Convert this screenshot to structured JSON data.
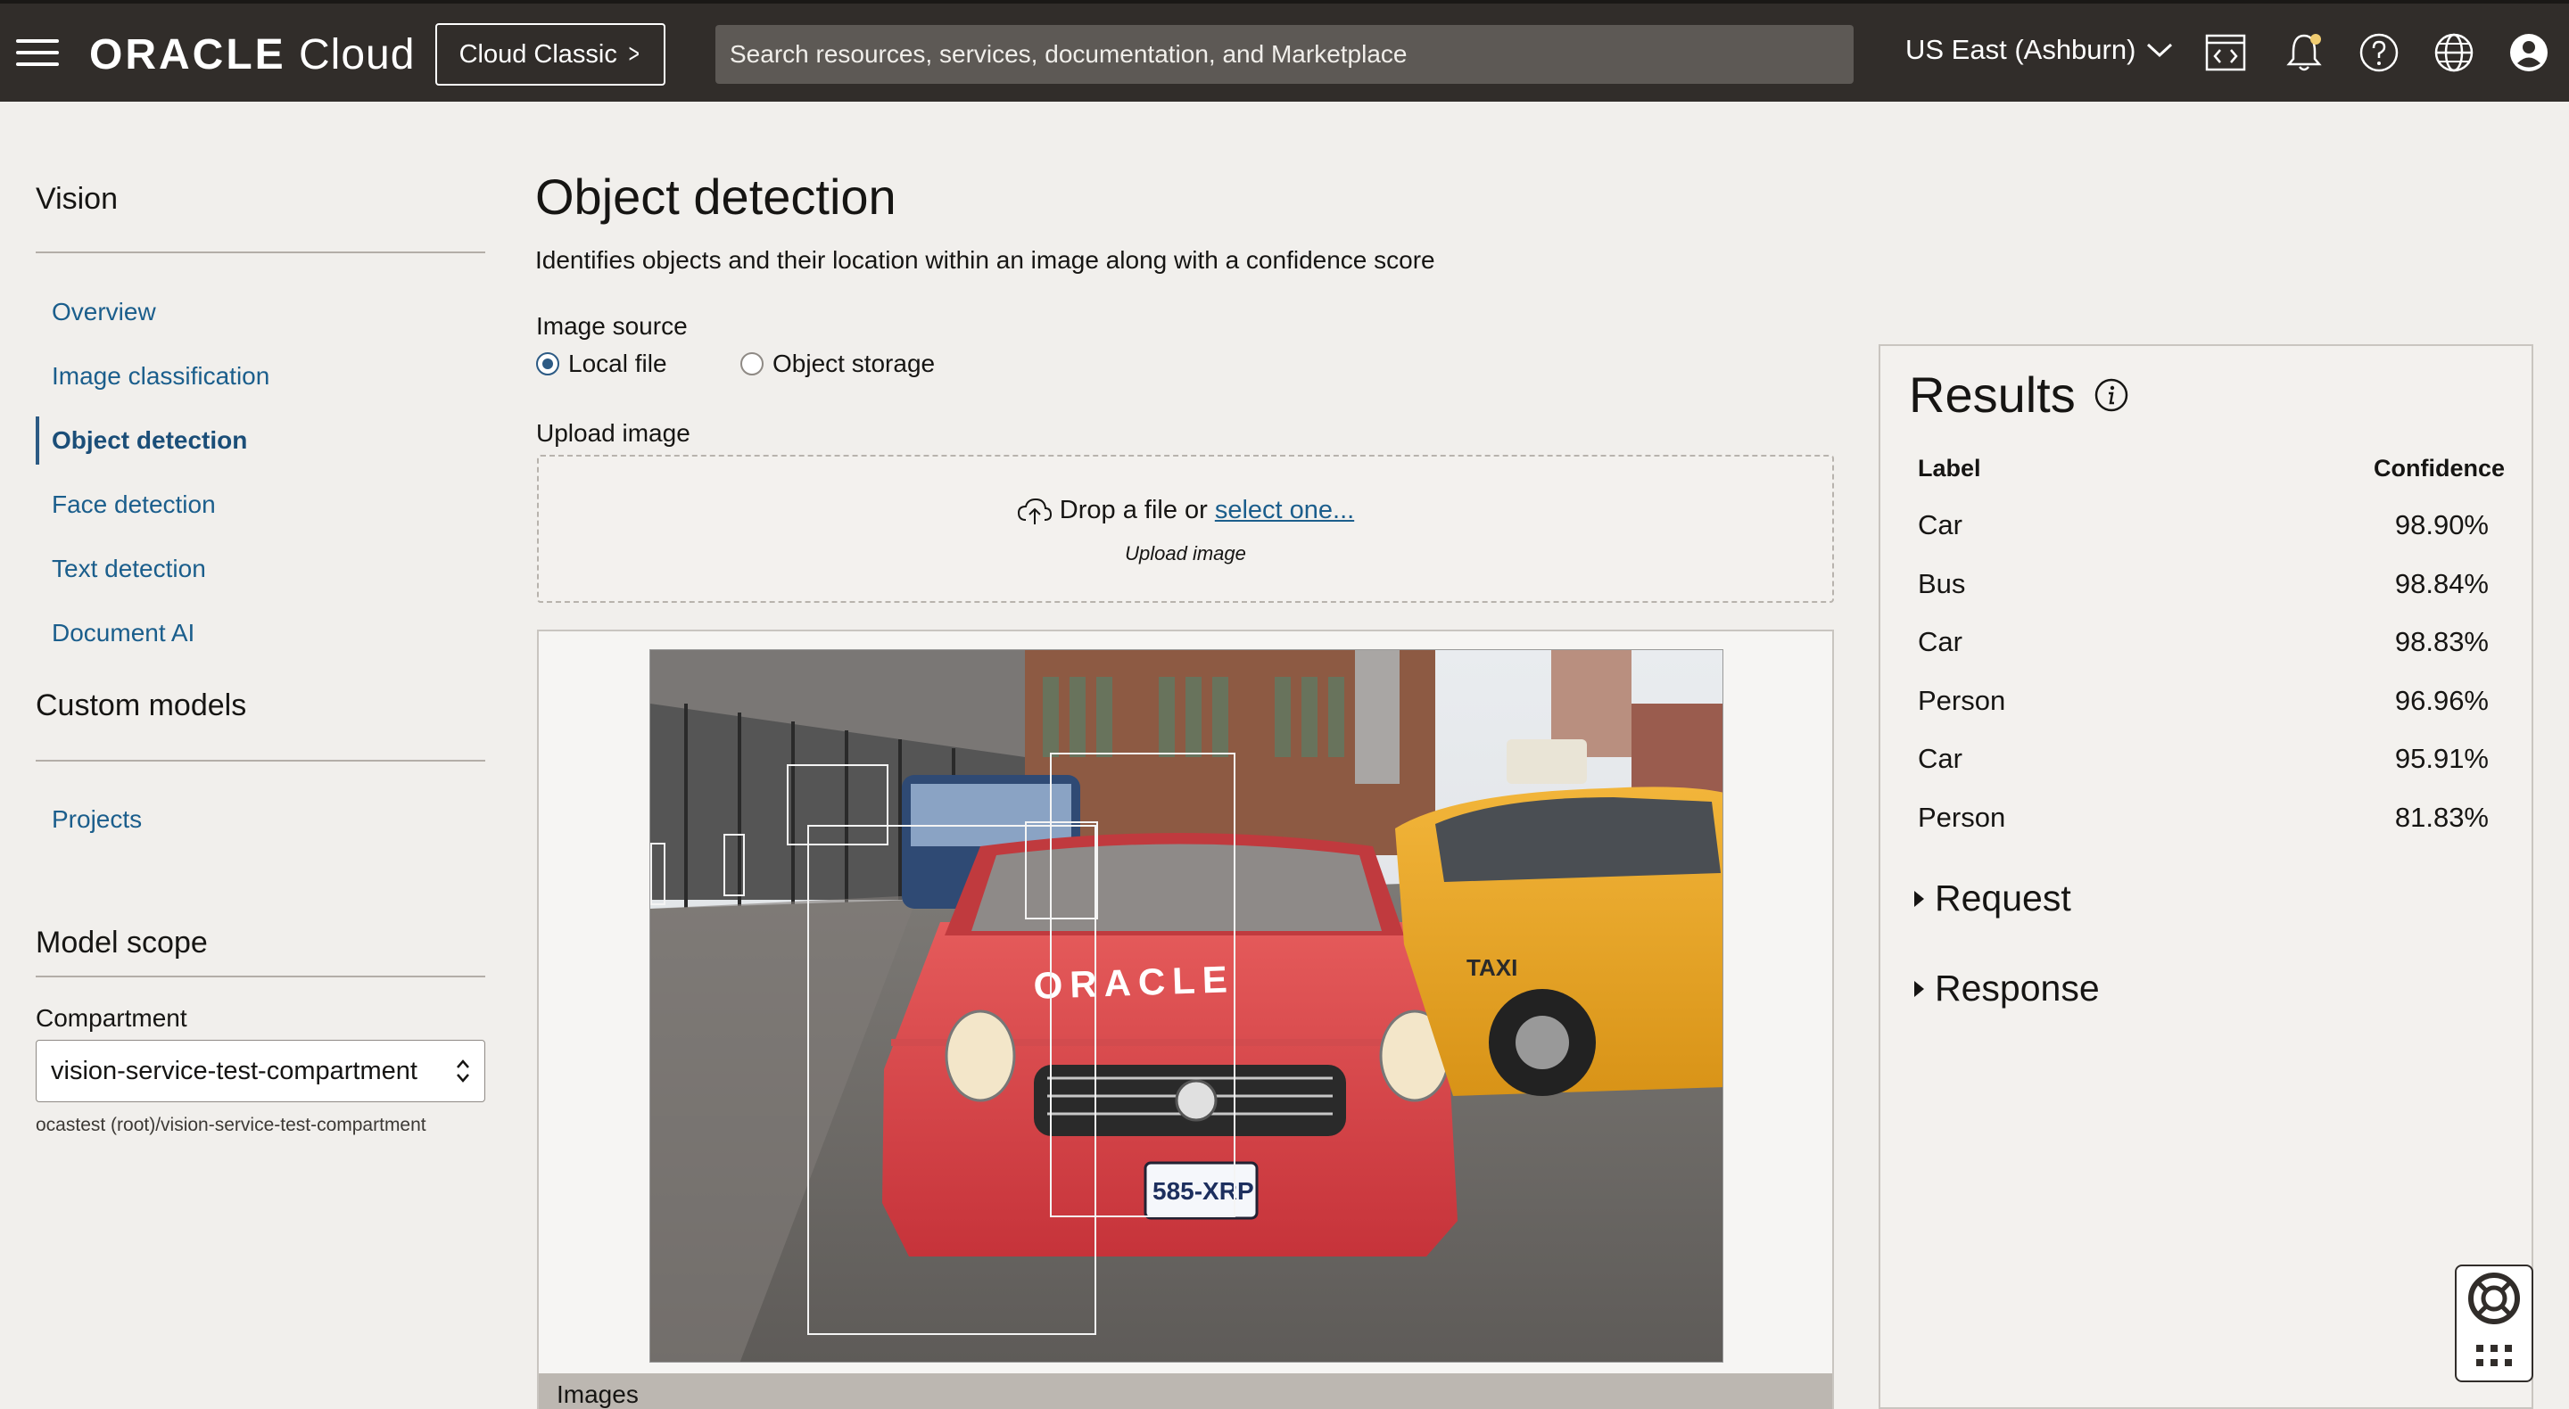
{
  "header": {
    "brand": "ORACLE",
    "product": "Cloud",
    "classic_button": "Cloud Classic",
    "search_placeholder": "Search resources, services, documentation, and Marketplace",
    "region": "US East (Ashburn)",
    "icons": [
      "code-editor-icon",
      "bell-icon",
      "help-icon",
      "globe-icon",
      "user-icon"
    ]
  },
  "sidebar": {
    "section_title": "Vision",
    "items": [
      {
        "label": "Overview",
        "active": false
      },
      {
        "label": "Image classification",
        "active": false
      },
      {
        "label": "Object detection",
        "active": true
      },
      {
        "label": "Face detection",
        "active": false
      },
      {
        "label": "Text detection",
        "active": false
      },
      {
        "label": "Document AI",
        "active": false
      }
    ],
    "custom_models_title": "Custom models",
    "custom_items": [
      {
        "label": "Projects"
      }
    ],
    "model_scope_title": "Model scope",
    "compartment_label": "Compartment",
    "compartment_value": "vision-service-test-compartment",
    "compartment_path": "ocastest (root)/vision-service-test-compartment"
  },
  "main": {
    "title": "Object detection",
    "description": "Identifies objects and their location within an image along with a confidence score",
    "image_source_label": "Image source",
    "sources": [
      {
        "label": "Local file",
        "selected": true
      },
      {
        "label": "Object storage",
        "selected": false
      }
    ],
    "upload_label": "Upload image",
    "dropzone_text": "Drop a file or",
    "dropzone_link": "select one...",
    "dropzone_sub": "Upload image",
    "images_bar": "Images"
  },
  "results": {
    "title": "Results",
    "col_label": "Label",
    "col_confidence": "Confidence",
    "rows": [
      {
        "label": "Car",
        "confidence": "98.90%"
      },
      {
        "label": "Bus",
        "confidence": "98.84%"
      },
      {
        "label": "Car",
        "confidence": "98.83%"
      },
      {
        "label": "Person",
        "confidence": "96.96%"
      },
      {
        "label": "Car",
        "confidence": "95.91%"
      },
      {
        "label": "Person",
        "confidence": "81.83%"
      }
    ],
    "request_label": "Request",
    "response_label": "Response"
  },
  "photo": {
    "car_brand_text": "ORACLE",
    "plate_text": "585-XRP",
    "taxi_text": "TAXI"
  }
}
